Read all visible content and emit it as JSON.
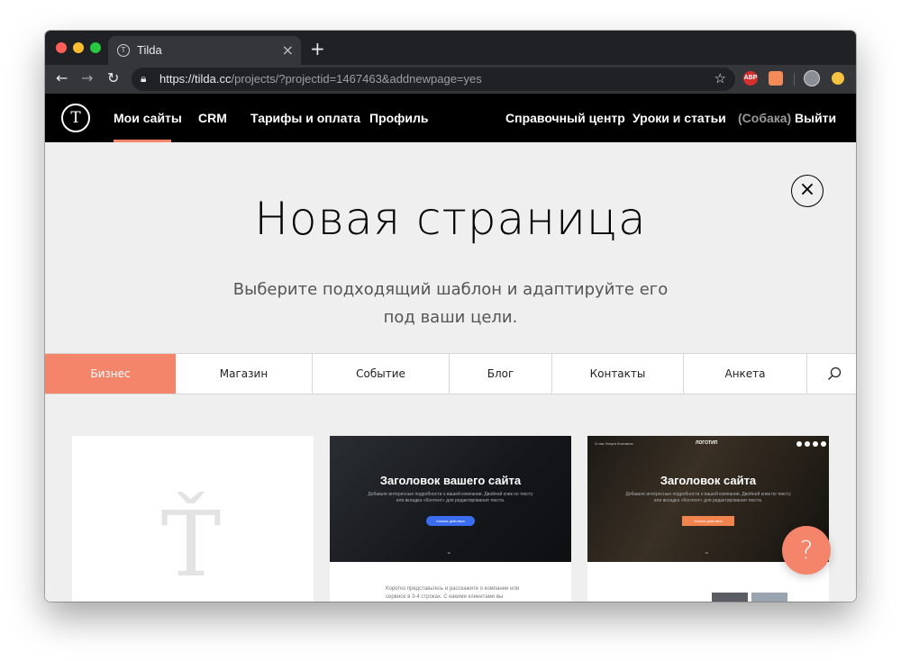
{
  "browser": {
    "tab_title": "Tilda",
    "tab_favicon": "T",
    "new_tab_icon": "+",
    "close_tab_icon": "×",
    "url_host": "https://tilda.cc",
    "url_path": "/projects/?projectid=1467463&addnewpage=yes",
    "extensions": {
      "abp_label": "ABP"
    }
  },
  "header": {
    "logo_letter": "T",
    "nav_left": [
      "Мои сайты",
      "CRM",
      "Тарифы и оплата",
      "Профиль"
    ],
    "nav_right": [
      "Справочный центр",
      "Уроки и статьи"
    ],
    "username": "(Собака)",
    "logout": "Выйти"
  },
  "main": {
    "close_icon": "×",
    "title": "Новая страница",
    "subtitle": "Выберите подходящий шаблон и адаптируйте его под ваши цели.",
    "categories": [
      "Бизнес",
      "Магазин",
      "Событие",
      "Блог",
      "Контакты",
      "Анкета"
    ],
    "active_category": "Бизнес"
  },
  "templates": [
    {
      "logo_mark": "Ť"
    },
    {
      "hero_title": "Заголовок вашего сайта",
      "hero_text": "Добавьте интересные подробности о вашей компании. Двойной клик по тексту или вкладка «Контент» для редактирования текста.",
      "button_label": "Кнопка действия",
      "body_text": "Коротко представьтесь и расскажите о компании или сервисе в 3-4 строках. С какими клиентами вы"
    },
    {
      "nav": "О нас   Услуги   Контакты",
      "logo": "ЛОГОТИП",
      "hero_title": "Заголовок сайта",
      "hero_text": "Добавьте интересные подробности о вашей компании. Двойной клик по тексту или вкладка «Контент» для редактирования текста.",
      "button_label": "Кнопка действия"
    }
  ],
  "help": {
    "label": "?"
  },
  "colors": {
    "accent": "#f4846a",
    "header_bg": "#000000",
    "page_bg": "#efefef",
    "link_blue": "#3a6df0"
  },
  "icons": {
    "search": "search-icon",
    "close": "close-icon",
    "star": "star-icon",
    "lock": "lock-icon"
  }
}
